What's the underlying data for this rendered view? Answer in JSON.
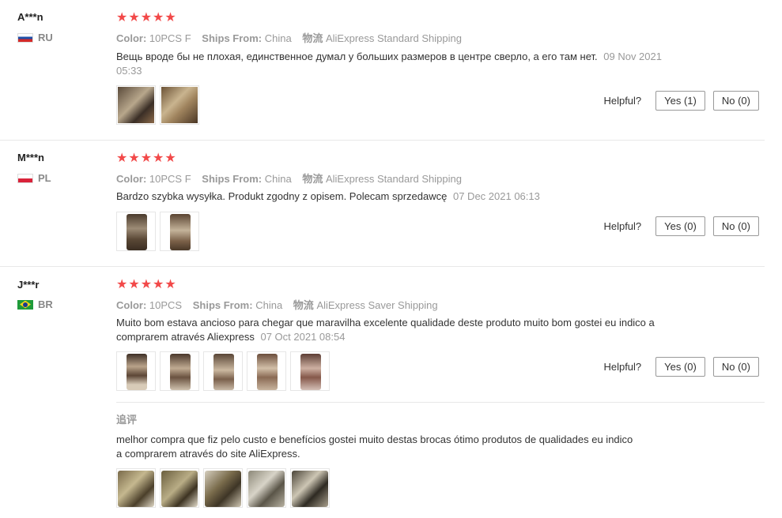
{
  "ui": {
    "helpful_label": "Helpful?",
    "color_key": "Color:",
    "ships_key": "Ships From:",
    "logistics_key": "物流"
  },
  "colors": {
    "stars": "#f24949",
    "meta": "#999999",
    "border": "#e8e8e8"
  },
  "reviews": [
    {
      "user": "A***n",
      "country": "RU",
      "stars": "★★★★★",
      "color": "10PCS F",
      "ships_from": "China",
      "logistics": "AliExpress Standard Shipping",
      "text": "Вещь вроде бы не плохая, единственное думал у больших размеров в центре сверло, а его там нет.",
      "date": "09 Nov 2021 05:33",
      "yes": "Yes (1)",
      "no": "No (0)"
    },
    {
      "user": "M***n",
      "country": "PL",
      "stars": "★★★★★",
      "color": "10PCS F",
      "ships_from": "China",
      "logistics": "AliExpress Standard Shipping",
      "text": "Bardzo szybka wysyłka. Produkt zgodny z opisem. Polecam sprzedawcę",
      "date": "07 Dec 2021 06:13",
      "yes": "Yes (0)",
      "no": "No (0)"
    },
    {
      "user": "J***r",
      "country": "BR",
      "stars": "★★★★★",
      "color": "10PCS",
      "ships_from": "China",
      "logistics": "AliExpress Saver Shipping",
      "text": "Muito bom estava ancioso para chegar que maravilha excelente qualidade deste produto muito bom gostei eu indico a comprarem através Aliexpress",
      "date": "07 Oct 2021 08:54",
      "yes": "Yes (0)",
      "no": "No (0)",
      "followup_title": "追评",
      "followup_text": "melhor compra que fiz pelo custo e benefícios gostei muito destas brocas ótimo produtos de qualidades eu indico a comprarem através do site AliExpress."
    }
  ]
}
